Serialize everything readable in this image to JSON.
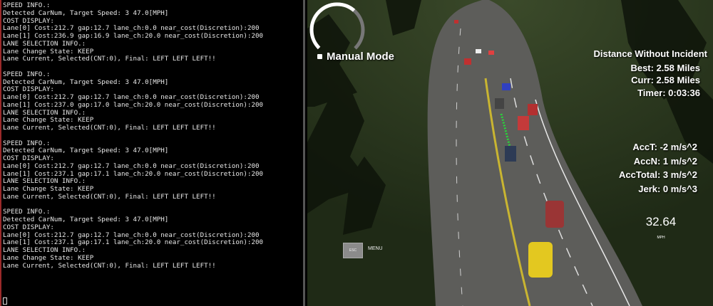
{
  "terminal": {
    "lines": [
      "SPEED INFO.:",
      "Detected CarNum, Target Speed: 3 47.0[MPH]",
      "COST DISPLAY:",
      "Lane[0] Cost:212.7 gap:12.7 lane_ch:0.0 near_cost(Discretion):200",
      "Lane[1] Cost:236.9 gap:16.9 lane_ch:20.0 near_cost(Discretion):200",
      "LANE SELECTION INFO.:",
      "Lane Change State: KEEP",
      "Lane Current, Selected(CNT:0), Final: LEFT LEFT LEFT!!",
      "",
      "SPEED INFO.:",
      "Detected CarNum, Target Speed: 3 47.0[MPH]",
      "COST DISPLAY:",
      "Lane[0] Cost:212.7 gap:12.7 lane_ch:0.0 near_cost(Discretion):200",
      "Lane[1] Cost:237.0 gap:17.0 lane_ch:20.0 near_cost(Discretion):200",
      "LANE SELECTION INFO.:",
      "Lane Change State: KEEP",
      "Lane Current, Selected(CNT:0), Final: LEFT LEFT LEFT!!",
      "",
      "SPEED INFO.:",
      "Detected CarNum, Target Speed: 3 47.0[MPH]",
      "COST DISPLAY:",
      "Lane[0] Cost:212.7 gap:12.7 lane_ch:0.0 near_cost(Discretion):200",
      "Lane[1] Cost:237.1 gap:17.1 lane_ch:20.0 near_cost(Discretion):200",
      "LANE SELECTION INFO.:",
      "Lane Change State: KEEP",
      "Lane Current, Selected(CNT:0), Final: LEFT LEFT LEFT!!",
      "",
      "SPEED INFO.:",
      "Detected CarNum, Target Speed: 3 47.0[MPH]",
      "COST DISPLAY:",
      "Lane[0] Cost:212.7 gap:12.7 lane_ch:0.0 near_cost(Discretion):200",
      "Lane[1] Cost:237.1 gap:17.1 lane_ch:20.0 near_cost(Discretion):200",
      "LANE SELECTION INFO.:",
      "Lane Change State: KEEP",
      "Lane Current, Selected(CNT:0), Final: LEFT LEFT LEFT!!",
      ""
    ]
  },
  "simulator": {
    "mode_label": "Manual Mode",
    "distance_title": "Distance Without Incident",
    "best": "Best: 2.58 Miles",
    "curr": "Curr: 2.58 Miles",
    "timer": "Timer: 0:03:36",
    "acc_t": "AccT: -2 m/s^2",
    "acc_n": "AccN: 1 m/s^2",
    "acc_total": "AccTotal: 3 m/s^2",
    "jerk": "Jerk: 0 m/s^3",
    "speed": "32.64",
    "speed_unit": "MPH",
    "esc_label": "ESC",
    "menu_label": "MENU",
    "speed_fraction": 0.65
  },
  "colors": {
    "grass": "#2a3a1c",
    "road": "#5d5d5a",
    "lane_yellow": "#c9b531",
    "path_green": "#29d63a",
    "ego_car": "#e3c820"
  }
}
